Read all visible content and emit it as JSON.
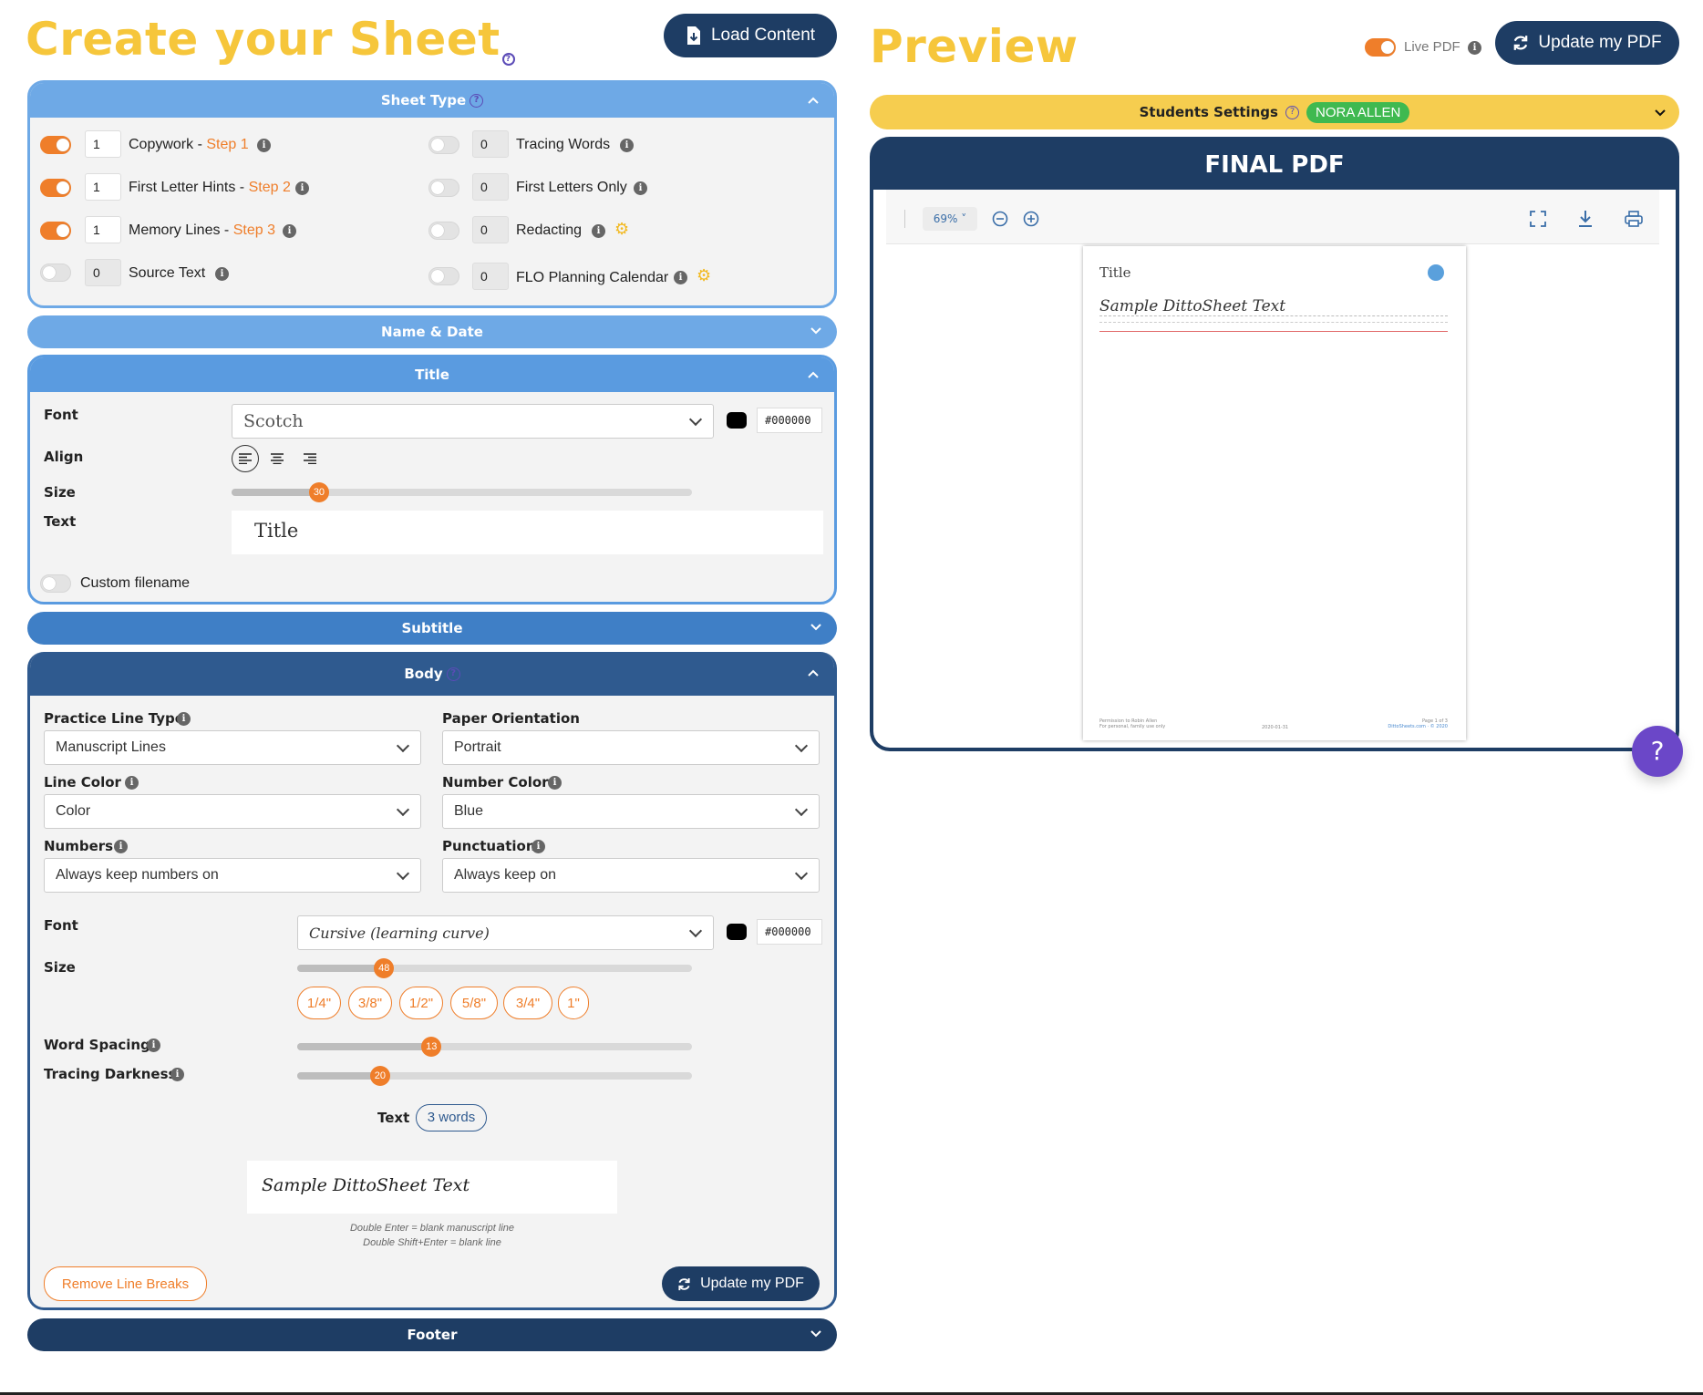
{
  "left": {
    "title": "Create your Sheet",
    "load_button": "Load Content",
    "sheet_type": {
      "header": "Sheet Type",
      "left_items": [
        {
          "count": "1",
          "label": "Copywork - ",
          "step": "Step 1",
          "on": true
        },
        {
          "count": "1",
          "label": "First Letter Hints - ",
          "step": "Step 2",
          "on": true
        },
        {
          "count": "1",
          "label": "Memory Lines - ",
          "step": "Step 3",
          "on": true
        },
        {
          "count": "0",
          "label": "Source Text",
          "step": "",
          "on": false
        }
      ],
      "right_items": [
        {
          "count": "0",
          "label": "Tracing Words",
          "on": false
        },
        {
          "count": "0",
          "label": "First Letters Only",
          "on": false
        },
        {
          "count": "0",
          "label": "Redacting",
          "on": false
        },
        {
          "count": "0",
          "label": "FLO Planning Calendar",
          "on": false
        }
      ]
    },
    "name_date": {
      "header": "Name & Date"
    },
    "title_section": {
      "header": "Title",
      "font_label": "Font",
      "font_value": "Scotch",
      "color_hex": "#000000",
      "align_label": "Align",
      "size_label": "Size",
      "size_value": "30",
      "size_fraction": 0.19,
      "text_label": "Text",
      "text_value": "Title",
      "custom_filename": "Custom filename"
    },
    "subtitle": {
      "header": "Subtitle"
    },
    "body": {
      "header": "Body",
      "practice_line_type_label": "Practice Line Type",
      "practice_line_type_value": "Manuscript Lines",
      "paper_orientation_label": "Paper Orientation",
      "paper_orientation_value": "Portrait",
      "line_color_label": "Line Color",
      "line_color_value": "Color",
      "number_color_label": "Number Color",
      "number_color_value": "Blue",
      "numbers_label": "Numbers",
      "numbers_value": "Always keep numbers on",
      "punctuation_label": "Punctuation",
      "punctuation_value": "Always keep on",
      "font_label": "Font",
      "font_value": "Cursive (learning curve)",
      "color_hex": "#000000",
      "size_label": "Size",
      "size_value": "48",
      "size_fraction": 0.22,
      "size_presets": [
        "1/4\"",
        "3/8\"",
        "1/2\"",
        "5/8\"",
        "3/4\"",
        "1\""
      ],
      "word_spacing_label": "Word Spacing",
      "word_spacing_value": "13",
      "word_spacing_fraction": 0.34,
      "tracing_darkness_label": "Tracing Darkness",
      "tracing_darkness_value": "20",
      "tracing_darkness_fraction": 0.21,
      "text_label": "Text",
      "word_count": "3 words",
      "text_value": "Sample DittoSheet Text",
      "hint_1": "Double Enter = blank manuscript line",
      "hint_2": "Double Shift+Enter = blank line",
      "remove_line_breaks": "Remove Line Breaks",
      "update_button": "Update my PDF"
    },
    "footer": {
      "header": "Footer"
    }
  },
  "right": {
    "title": "Preview",
    "live_pdf_label": "Live PDF",
    "update_button": "Update my PDF",
    "students_settings": "Students Settings",
    "student_name": "NORA ALLEN",
    "final_pdf": "FINAL PDF",
    "zoom": "69%",
    "page": {
      "title": "Title",
      "sample_text": "Sample DittoSheet Text",
      "footer_left_1": "Permission to Robin Allen",
      "footer_left_2": "For personal, family use only",
      "footer_date": "2020-01-31",
      "footer_page": "Page 1 of 3",
      "footer_brand": "DittoSheets.com · © 2020"
    }
  },
  "help_button": "?",
  "colors": {
    "yellow": "#f6c63b",
    "orange": "#ef7e2a",
    "navy": "#1e3d64",
    "blue": "#4f8fd6",
    "green": "#3fb950"
  },
  "icons": [
    "info-icon",
    "gear-icon",
    "chevron-up-icon",
    "chevron-down-icon",
    "refresh-icon",
    "file-load-icon",
    "help-circle-icon",
    "fullscreen-icon",
    "download-icon",
    "print-icon",
    "zoom-in-icon",
    "zoom-out-icon",
    "align-left-icon",
    "align-center-icon",
    "align-right-icon"
  ]
}
